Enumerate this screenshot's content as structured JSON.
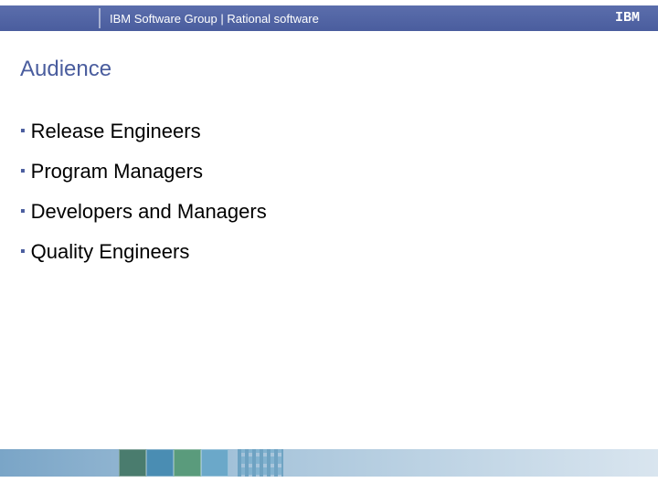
{
  "header": {
    "text": "IBM Software Group | Rational software",
    "logo": "IBM"
  },
  "slide": {
    "title": "Audience",
    "bullets": [
      "Release Engineers",
      "Program Managers",
      "Developers and Managers",
      "Quality Engineers"
    ]
  }
}
